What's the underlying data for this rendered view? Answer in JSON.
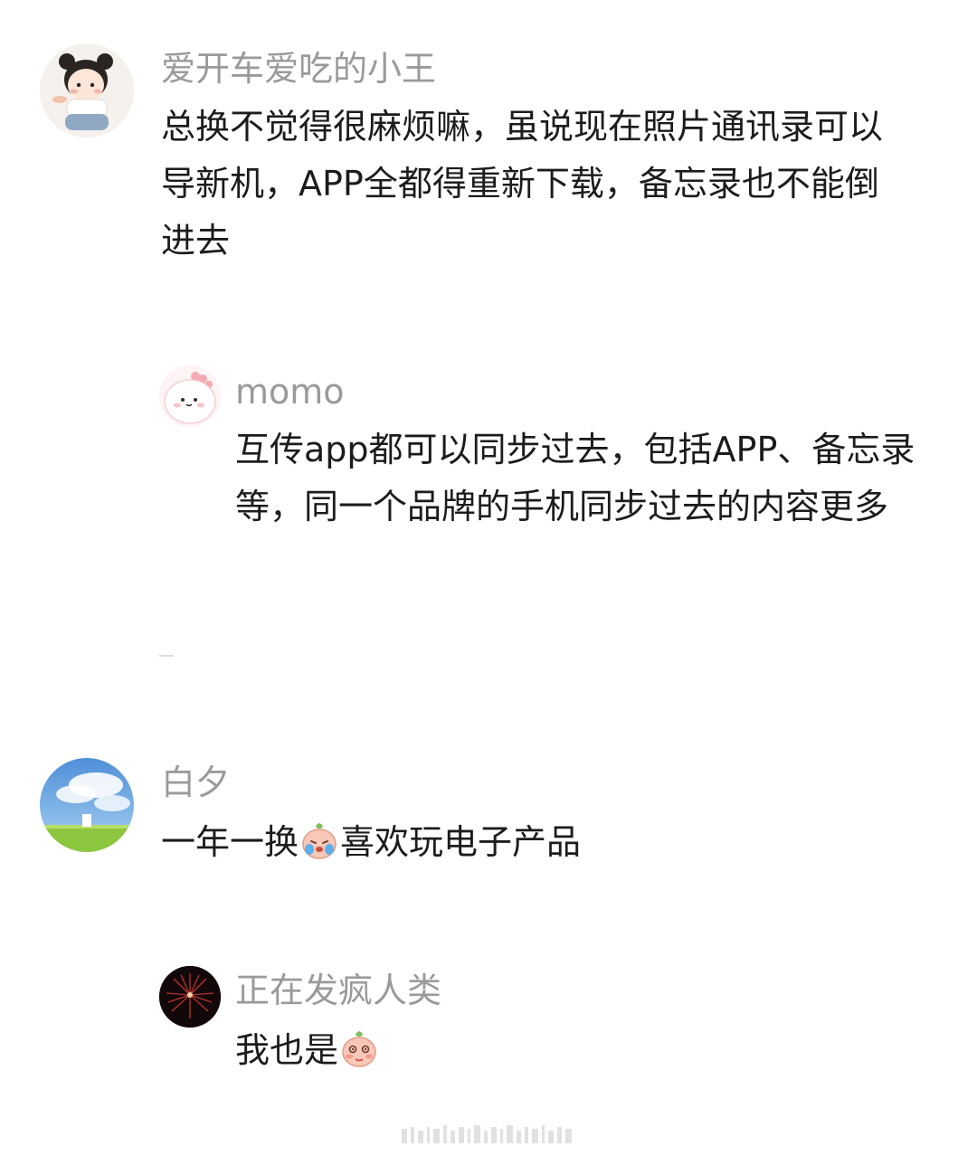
{
  "comments": [
    {
      "username": "爱开车爱吃的小王",
      "avatar_icon": "cartoon-girl-avatar",
      "lines": [
        "总换不觉得很麻烦嘛，虽说现在照片通讯录可以",
        "导新机，APP全都得重新下载，备忘录也不能倒",
        "进去"
      ],
      "replies": [
        {
          "username": "momo",
          "avatar_icon": "pink-blob-avatar",
          "lines": [
            "互传app都可以同步过去，包括APP、备忘录",
            "等，同一个品牌的手机同步过去的内容更多"
          ]
        }
      ]
    },
    {
      "username": "白夕",
      "avatar_icon": "sky-field-avatar",
      "text_before_emoji": "一年一换",
      "emoji": "crying-peach-emoji",
      "text_after_emoji": "喜欢玩电子产品",
      "replies": [
        {
          "username": "正在发疯人类",
          "avatar_icon": "fireworks-avatar",
          "text_before_emoji": "我也是",
          "emoji": "shy-peach-emoji"
        }
      ]
    }
  ],
  "colors": {
    "username": "#9a9a9a",
    "text": "#1c1c1c",
    "background": "#ffffff"
  }
}
